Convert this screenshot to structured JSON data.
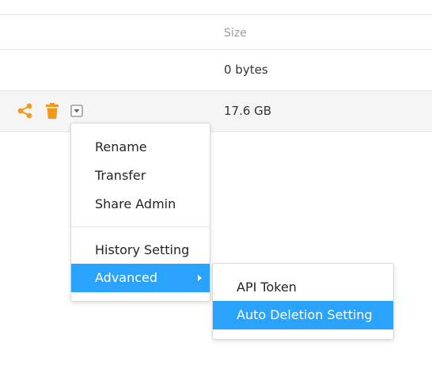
{
  "table": {
    "header": {
      "size_label": "Size"
    },
    "rows": [
      {
        "size": "0 bytes"
      },
      {
        "size": "17.6 GB"
      }
    ]
  },
  "row_actions": {
    "icons": [
      "share-icon",
      "trash-icon",
      "dropdown-toggle-icon"
    ],
    "accent_color": "#f19a1c"
  },
  "context_menu": {
    "items": [
      {
        "label": "Rename"
      },
      {
        "label": "Transfer"
      },
      {
        "label": "Share Admin"
      },
      {
        "label": "History Setting"
      },
      {
        "label": "Advanced",
        "has_submenu": true,
        "active": true
      }
    ],
    "highlight_color": "#2aa3ff"
  },
  "advanced_submenu": {
    "items": [
      {
        "label": "API Token"
      },
      {
        "label": "Auto Deletion Setting",
        "active": true
      }
    ]
  }
}
